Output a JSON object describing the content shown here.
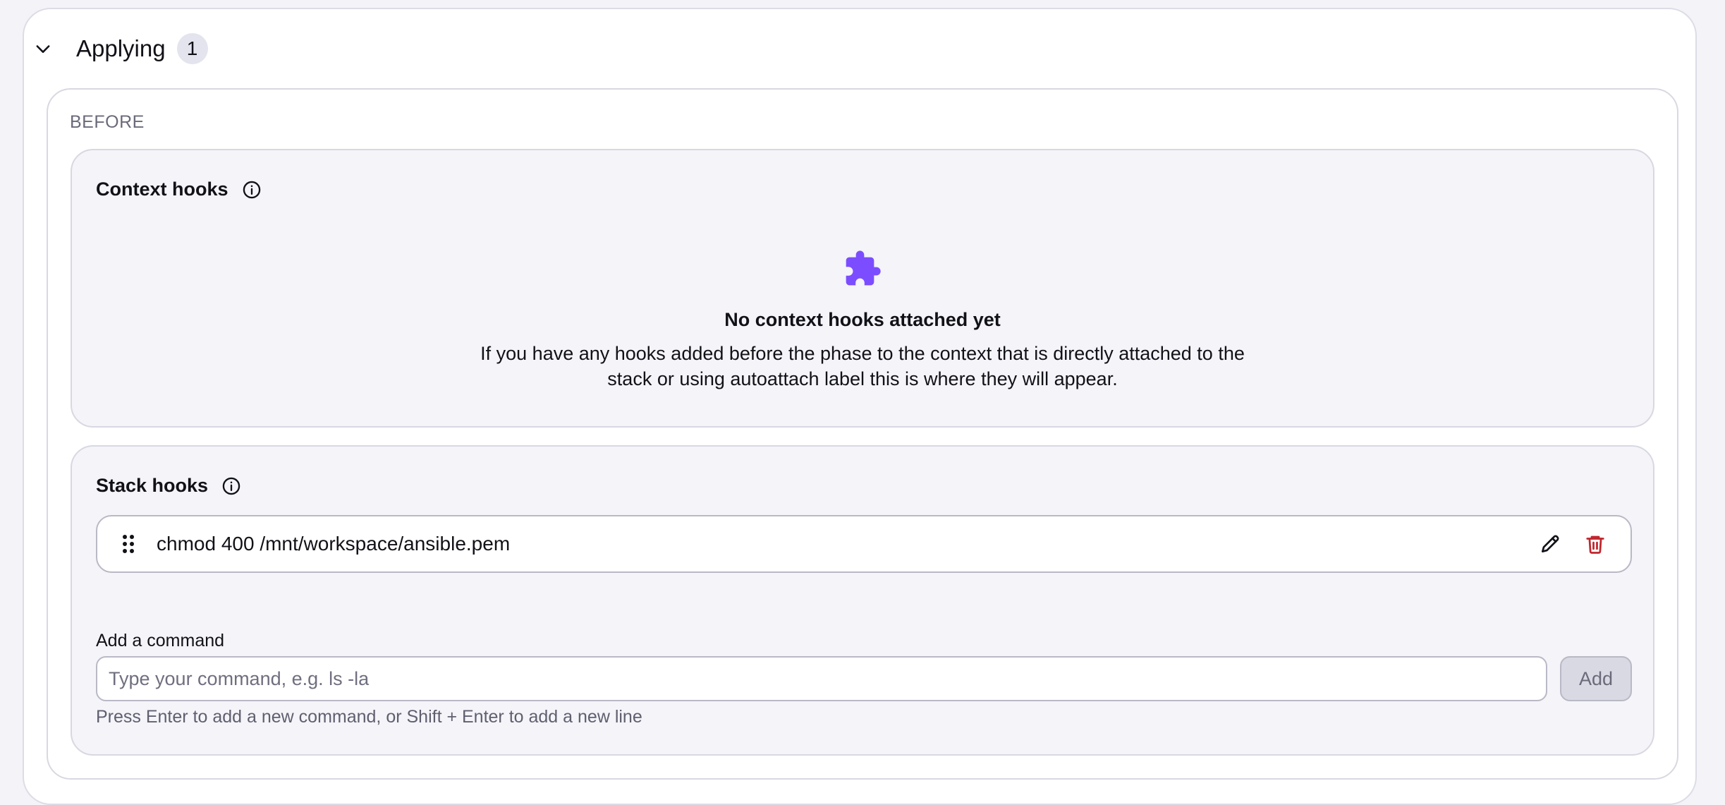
{
  "section": {
    "title": "Applying",
    "count": "1"
  },
  "phase": {
    "label": "BEFORE"
  },
  "context_hooks": {
    "title": "Context hooks",
    "empty_title": "No context hooks attached yet",
    "empty_description": "If you have any hooks added before the phase to the context that is directly attached to the stack or using autoattach label this is where they will appear.",
    "icon": "puzzle-icon"
  },
  "stack_hooks": {
    "title": "Stack hooks",
    "items": [
      {
        "command": "chmod 400 /mnt/workspace/ansible.pem"
      }
    ]
  },
  "add_command": {
    "label": "Add a command",
    "placeholder": "Type your command, e.g. ls -la",
    "button_label": "Add",
    "hint": "Press Enter to add a new command, or Shift + Enter to add a new line"
  },
  "colors": {
    "accent_purple": "#7c4dff",
    "delete_red": "#c0262d"
  }
}
